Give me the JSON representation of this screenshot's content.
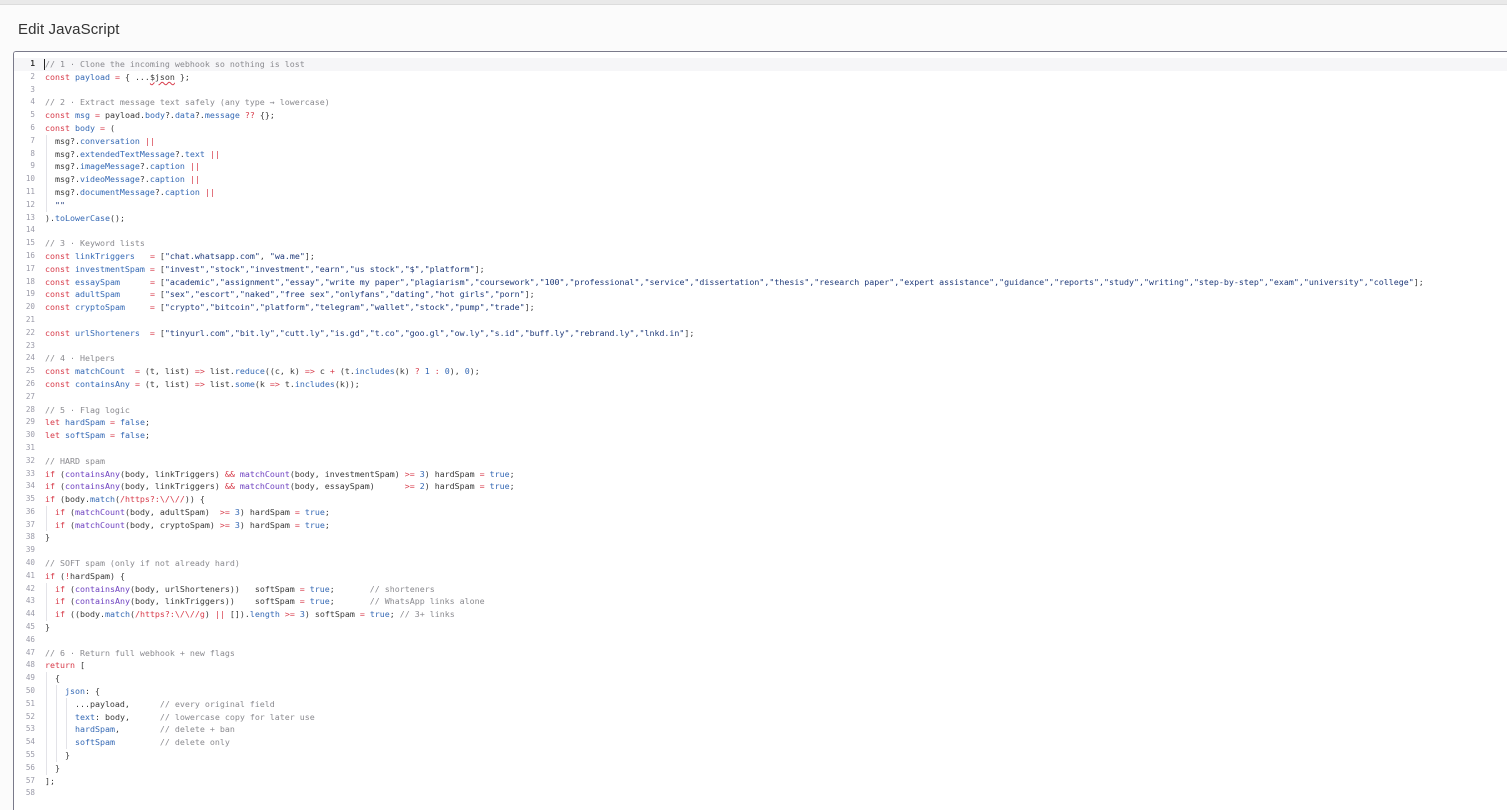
{
  "dialog": {
    "title": "Edit JavaScript"
  },
  "editor": {
    "language": "javascript",
    "active_line": 1,
    "lines": [
      [
        [
          "c",
          "// 1 · Clone the incoming webhook so nothing is lost"
        ]
      ],
      [
        [
          "k",
          "const"
        ],
        [
          "p",
          " "
        ],
        [
          "v",
          "payload"
        ],
        [
          "p",
          " "
        ],
        [
          "o",
          "="
        ],
        [
          "p",
          " { ..."
        ],
        [
          "u",
          "$json"
        ],
        [
          "p",
          " };"
        ]
      ],
      [],
      [
        [
          "c",
          "// 2 · Extract message text safely (any type → lowercase)"
        ]
      ],
      [
        [
          "k",
          "const"
        ],
        [
          "p",
          " "
        ],
        [
          "v",
          "msg"
        ],
        [
          "p",
          " "
        ],
        [
          "o",
          "="
        ],
        [
          "p",
          " payload."
        ],
        [
          "v",
          "body"
        ],
        [
          "p",
          "?."
        ],
        [
          "v",
          "data"
        ],
        [
          "p",
          "?."
        ],
        [
          "v",
          "message"
        ],
        [
          "p",
          " "
        ],
        [
          "o",
          "??"
        ],
        [
          "p",
          " {};"
        ]
      ],
      [
        [
          "k",
          "const"
        ],
        [
          "p",
          " "
        ],
        [
          "v",
          "body"
        ],
        [
          "p",
          " "
        ],
        [
          "o",
          "="
        ],
        [
          "p",
          " ("
        ]
      ],
      [
        [
          "p",
          "  msg?."
        ],
        [
          "v",
          "conversation"
        ],
        [
          "p",
          " "
        ],
        [
          "o",
          "||"
        ]
      ],
      [
        [
          "p",
          "  msg?."
        ],
        [
          "v",
          "extendedTextMessage"
        ],
        [
          "p",
          "?."
        ],
        [
          "v",
          "text"
        ],
        [
          "p",
          " "
        ],
        [
          "o",
          "||"
        ]
      ],
      [
        [
          "p",
          "  msg?."
        ],
        [
          "v",
          "imageMessage"
        ],
        [
          "p",
          "?."
        ],
        [
          "v",
          "caption"
        ],
        [
          "p",
          " "
        ],
        [
          "o",
          "||"
        ]
      ],
      [
        [
          "p",
          "  msg?."
        ],
        [
          "v",
          "videoMessage"
        ],
        [
          "p",
          "?."
        ],
        [
          "v",
          "caption"
        ],
        [
          "p",
          " "
        ],
        [
          "o",
          "||"
        ]
      ],
      [
        [
          "p",
          "  msg?."
        ],
        [
          "v",
          "documentMessage"
        ],
        [
          "p",
          "?."
        ],
        [
          "v",
          "caption"
        ],
        [
          "p",
          " "
        ],
        [
          "o",
          "||"
        ]
      ],
      [
        [
          "p",
          "  "
        ],
        [
          "s",
          "\"\""
        ]
      ],
      [
        [
          "p",
          ")."
        ],
        [
          "v",
          "toLowerCase"
        ],
        [
          "p",
          "();"
        ]
      ],
      [],
      [
        [
          "c",
          "// 3 · Keyword lists"
        ]
      ],
      [
        [
          "k",
          "const"
        ],
        [
          "p",
          " "
        ],
        [
          "v",
          "linkTriggers"
        ],
        [
          "p",
          "   "
        ],
        [
          "o",
          "="
        ],
        [
          "p",
          " ["
        ],
        [
          "s",
          "\"chat.whatsapp.com\""
        ],
        [
          "p",
          ", "
        ],
        [
          "s",
          "\"wa.me\""
        ],
        [
          "p",
          "];"
        ]
      ],
      [
        [
          "k",
          "const"
        ],
        [
          "p",
          " "
        ],
        [
          "v",
          "investmentSpam"
        ],
        [
          "p",
          " "
        ],
        [
          "o",
          "="
        ],
        [
          "p",
          " ["
        ],
        [
          "s",
          "\"invest\",\"stock\",\"investment\",\"earn\",\"us stock\",\"$\",\"platform\""
        ],
        [
          "p",
          "];"
        ]
      ],
      [
        [
          "k",
          "const"
        ],
        [
          "p",
          " "
        ],
        [
          "v",
          "essaySpam"
        ],
        [
          "p",
          "      "
        ],
        [
          "o",
          "="
        ],
        [
          "p",
          " ["
        ],
        [
          "s",
          "\"academic\",\"assignment\",\"essay\",\"write my paper\",\"plagiarism\",\"coursework\",\"100\",\"professional\",\"service\",\"dissertation\",\"thesis\",\"research paper\",\"expert assistance\",\"guidance\",\"reports\",\"study\",\"writing\",\"step-by-step\",\"exam\",\"university\",\"college\""
        ],
        [
          "p",
          "];"
        ]
      ],
      [
        [
          "k",
          "const"
        ],
        [
          "p",
          " "
        ],
        [
          "v",
          "adultSpam"
        ],
        [
          "p",
          "      "
        ],
        [
          "o",
          "="
        ],
        [
          "p",
          " ["
        ],
        [
          "s",
          "\"sex\",\"escort\",\"naked\",\"free sex\",\"onlyfans\",\"dating\",\"hot girls\",\"porn\""
        ],
        [
          "p",
          "];"
        ]
      ],
      [
        [
          "k",
          "const"
        ],
        [
          "p",
          " "
        ],
        [
          "v",
          "cryptoSpam"
        ],
        [
          "p",
          "     "
        ],
        [
          "o",
          "="
        ],
        [
          "p",
          " ["
        ],
        [
          "s",
          "\"crypto\",\"bitcoin\",\"platform\",\"telegram\",\"wallet\",\"stock\",\"pump\",\"trade\""
        ],
        [
          "p",
          "];"
        ]
      ],
      [],
      [
        [
          "k",
          "const"
        ],
        [
          "p",
          " "
        ],
        [
          "v",
          "urlShorteners"
        ],
        [
          "p",
          "  "
        ],
        [
          "o",
          "="
        ],
        [
          "p",
          " ["
        ],
        [
          "s",
          "\"tinyurl.com\",\"bit.ly\",\"cutt.ly\",\"is.gd\",\"t.co\",\"goo.gl\",\"ow.ly\",\"s.id\",\"buff.ly\",\"rebrand.ly\",\"lnkd.in\""
        ],
        [
          "p",
          "];"
        ]
      ],
      [],
      [
        [
          "c",
          "// 4 · Helpers"
        ]
      ],
      [
        [
          "k",
          "const"
        ],
        [
          "p",
          " "
        ],
        [
          "v",
          "matchCount"
        ],
        [
          "p",
          "  "
        ],
        [
          "o",
          "="
        ],
        [
          "p",
          " (t, list) "
        ],
        [
          "o",
          "=>"
        ],
        [
          "p",
          " list."
        ],
        [
          "v",
          "reduce"
        ],
        [
          "p",
          "((c, k) "
        ],
        [
          "o",
          "=>"
        ],
        [
          "p",
          " c "
        ],
        [
          "o",
          "+"
        ],
        [
          "p",
          " (t."
        ],
        [
          "v",
          "includes"
        ],
        [
          "p",
          "(k) "
        ],
        [
          "o",
          "?"
        ],
        [
          "p",
          " "
        ],
        [
          "n",
          "1"
        ],
        [
          "p",
          " "
        ],
        [
          "o",
          ":"
        ],
        [
          "p",
          " "
        ],
        [
          "n",
          "0"
        ],
        [
          "p",
          "), "
        ],
        [
          "n",
          "0"
        ],
        [
          "p",
          ");"
        ]
      ],
      [
        [
          "k",
          "const"
        ],
        [
          "p",
          " "
        ],
        [
          "v",
          "containsAny"
        ],
        [
          "p",
          " "
        ],
        [
          "o",
          "="
        ],
        [
          "p",
          " (t, list) "
        ],
        [
          "o",
          "=>"
        ],
        [
          "p",
          " list."
        ],
        [
          "v",
          "some"
        ],
        [
          "p",
          "(k "
        ],
        [
          "o",
          "=>"
        ],
        [
          "p",
          " t."
        ],
        [
          "v",
          "includes"
        ],
        [
          "p",
          "(k));"
        ]
      ],
      [],
      [
        [
          "c",
          "// 5 · Flag logic"
        ]
      ],
      [
        [
          "k",
          "let"
        ],
        [
          "p",
          " "
        ],
        [
          "v",
          "hardSpam"
        ],
        [
          "p",
          " "
        ],
        [
          "o",
          "="
        ],
        [
          "p",
          " "
        ],
        [
          "n",
          "false"
        ],
        [
          "p",
          ";"
        ]
      ],
      [
        [
          "k",
          "let"
        ],
        [
          "p",
          " "
        ],
        [
          "v",
          "softSpam"
        ],
        [
          "p",
          " "
        ],
        [
          "o",
          "="
        ],
        [
          "p",
          " "
        ],
        [
          "n",
          "false"
        ],
        [
          "p",
          ";"
        ]
      ],
      [],
      [
        [
          "c",
          "// HARD spam"
        ]
      ],
      [
        [
          "k",
          "if"
        ],
        [
          "p",
          " ("
        ],
        [
          "f",
          "containsAny"
        ],
        [
          "p",
          "(body, linkTriggers) "
        ],
        [
          "o",
          "&&"
        ],
        [
          "p",
          " "
        ],
        [
          "f",
          "matchCount"
        ],
        [
          "p",
          "(body, investmentSpam) "
        ],
        [
          "o",
          ">="
        ],
        [
          "p",
          " "
        ],
        [
          "n",
          "3"
        ],
        [
          "p",
          ") hardSpam "
        ],
        [
          "o",
          "="
        ],
        [
          "p",
          " "
        ],
        [
          "n",
          "true"
        ],
        [
          "p",
          ";"
        ]
      ],
      [
        [
          "k",
          "if"
        ],
        [
          "p",
          " ("
        ],
        [
          "f",
          "containsAny"
        ],
        [
          "p",
          "(body, linkTriggers) "
        ],
        [
          "o",
          "&&"
        ],
        [
          "p",
          " "
        ],
        [
          "f",
          "matchCount"
        ],
        [
          "p",
          "(body, essaySpam)      "
        ],
        [
          "o",
          ">="
        ],
        [
          "p",
          " "
        ],
        [
          "n",
          "2"
        ],
        [
          "p",
          ") hardSpam "
        ],
        [
          "o",
          "="
        ],
        [
          "p",
          " "
        ],
        [
          "n",
          "true"
        ],
        [
          "p",
          ";"
        ]
      ],
      [
        [
          "k",
          "if"
        ],
        [
          "p",
          " (body."
        ],
        [
          "v",
          "match"
        ],
        [
          "p",
          "("
        ],
        [
          "k",
          "/https?:\\/\\//"
        ],
        [
          "p",
          ")) {"
        ]
      ],
      [
        [
          "p",
          "  "
        ],
        [
          "k",
          "if"
        ],
        [
          "p",
          " ("
        ],
        [
          "f",
          "matchCount"
        ],
        [
          "p",
          "(body, adultSpam)  "
        ],
        [
          "o",
          ">="
        ],
        [
          "p",
          " "
        ],
        [
          "n",
          "3"
        ],
        [
          "p",
          ") hardSpam "
        ],
        [
          "o",
          "="
        ],
        [
          "p",
          " "
        ],
        [
          "n",
          "true"
        ],
        [
          "p",
          ";"
        ]
      ],
      [
        [
          "p",
          "  "
        ],
        [
          "k",
          "if"
        ],
        [
          "p",
          " ("
        ],
        [
          "f",
          "matchCount"
        ],
        [
          "p",
          "(body, cryptoSpam) "
        ],
        [
          "o",
          ">="
        ],
        [
          "p",
          " "
        ],
        [
          "n",
          "3"
        ],
        [
          "p",
          ") hardSpam "
        ],
        [
          "o",
          "="
        ],
        [
          "p",
          " "
        ],
        [
          "n",
          "true"
        ],
        [
          "p",
          ";"
        ]
      ],
      [
        [
          "p",
          "}"
        ]
      ],
      [],
      [
        [
          "c",
          "// SOFT spam (only if not already hard)"
        ]
      ],
      [
        [
          "k",
          "if"
        ],
        [
          "p",
          " ("
        ],
        [
          "o",
          "!"
        ],
        [
          "p",
          "hardSpam) {"
        ]
      ],
      [
        [
          "p",
          "  "
        ],
        [
          "k",
          "if"
        ],
        [
          "p",
          " ("
        ],
        [
          "f",
          "containsAny"
        ],
        [
          "p",
          "(body, urlShorteners))   softSpam "
        ],
        [
          "o",
          "="
        ],
        [
          "p",
          " "
        ],
        [
          "n",
          "true"
        ],
        [
          "p",
          ";       "
        ],
        [
          "c",
          "// shorteners"
        ]
      ],
      [
        [
          "p",
          "  "
        ],
        [
          "k",
          "if"
        ],
        [
          "p",
          " ("
        ],
        [
          "f",
          "containsAny"
        ],
        [
          "p",
          "(body, linkTriggers))    softSpam "
        ],
        [
          "o",
          "="
        ],
        [
          "p",
          " "
        ],
        [
          "n",
          "true"
        ],
        [
          "p",
          ";       "
        ],
        [
          "c",
          "// WhatsApp links alone"
        ]
      ],
      [
        [
          "p",
          "  "
        ],
        [
          "k",
          "if"
        ],
        [
          "p",
          " ((body."
        ],
        [
          "v",
          "match"
        ],
        [
          "p",
          "("
        ],
        [
          "k",
          "/https?:\\/\\//g"
        ],
        [
          "p",
          ") "
        ],
        [
          "o",
          "||"
        ],
        [
          "p",
          " [])."
        ],
        [
          "v",
          "length"
        ],
        [
          "p",
          " "
        ],
        [
          "o",
          ">="
        ],
        [
          "p",
          " "
        ],
        [
          "n",
          "3"
        ],
        [
          "p",
          ") softSpam "
        ],
        [
          "o",
          "="
        ],
        [
          "p",
          " "
        ],
        [
          "n",
          "true"
        ],
        [
          "p",
          "; "
        ],
        [
          "c",
          "// 3+ links"
        ]
      ],
      [
        [
          "p",
          "}"
        ]
      ],
      [],
      [
        [
          "c",
          "// 6 · Return full webhook + new flags"
        ]
      ],
      [
        [
          "k",
          "return"
        ],
        [
          "p",
          " ["
        ]
      ],
      [
        [
          "p",
          "  {"
        ]
      ],
      [
        [
          "p",
          "    "
        ],
        [
          "v",
          "json"
        ],
        [
          "p",
          ": {"
        ]
      ],
      [
        [
          "p",
          "      ...payload,      "
        ],
        [
          "c",
          "// every original field"
        ]
      ],
      [
        [
          "p",
          "      "
        ],
        [
          "v",
          "text"
        ],
        [
          "p",
          ": body,      "
        ],
        [
          "c",
          "// lowercase copy for later use"
        ]
      ],
      [
        [
          "p",
          "      "
        ],
        [
          "v",
          "hardSpam"
        ],
        [
          "p",
          ",        "
        ],
        [
          "c",
          "// delete + ban"
        ]
      ],
      [
        [
          "p",
          "      "
        ],
        [
          "v",
          "softSpam"
        ],
        [
          "p",
          "         "
        ],
        [
          "c",
          "// delete only"
        ]
      ],
      [
        [
          "p",
          "    }"
        ]
      ],
      [
        [
          "p",
          "  }"
        ]
      ],
      [
        [
          "p",
          "];"
        ]
      ],
      []
    ]
  }
}
